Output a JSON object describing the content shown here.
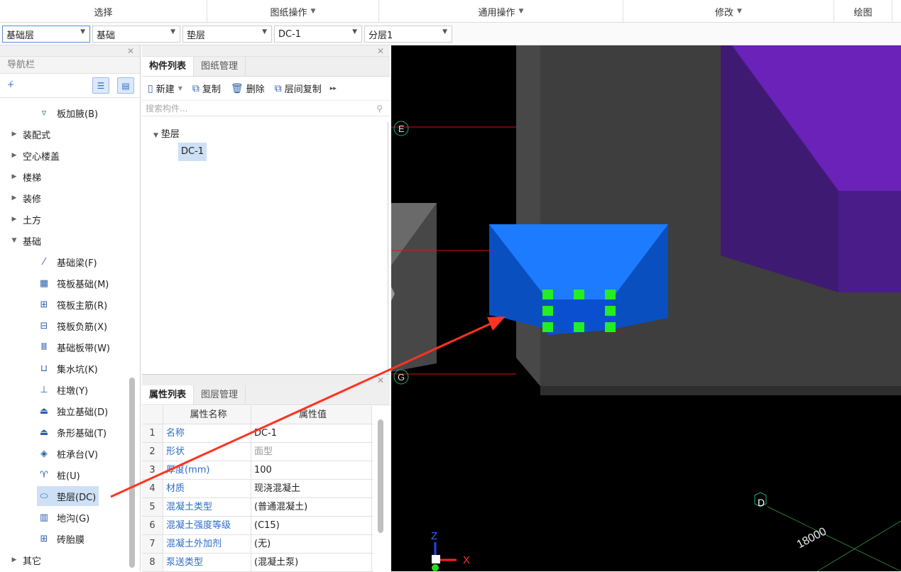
{
  "ribbon": {
    "groups": [
      {
        "label": "选择"
      },
      {
        "label": "图纸操作"
      },
      {
        "label": "通用操作"
      },
      {
        "label": "修改"
      },
      {
        "label": "绘图"
      }
    ]
  },
  "selectors": [
    {
      "value": "基础层"
    },
    {
      "value": "基础"
    },
    {
      "value": "垫层"
    },
    {
      "value": "DC-1"
    },
    {
      "value": "分层1"
    }
  ],
  "nav": {
    "title": "导航栏",
    "items": [
      {
        "label": "板加腋(B)",
        "icon": "slab-haunch-icon"
      },
      {
        "label": "装配式",
        "icon": "expand-arrow-icon"
      },
      {
        "label": "空心楼盖",
        "icon": "expand-arrow-icon"
      },
      {
        "label": "楼梯",
        "icon": "expand-arrow-icon"
      },
      {
        "label": "装修",
        "icon": "expand-arrow-icon"
      },
      {
        "label": "土方",
        "icon": "expand-arrow-icon"
      },
      {
        "label": "基础",
        "icon": "collapse-arrow-icon"
      },
      {
        "label": "基础梁(F)",
        "icon": "foundation-beam-icon"
      },
      {
        "label": "筏板基础(M)",
        "icon": "raft-foundation-icon"
      },
      {
        "label": "筏板主筋(R)",
        "icon": "raft-main-rebar-icon"
      },
      {
        "label": "筏板负筋(X)",
        "icon": "raft-negative-rebar-icon"
      },
      {
        "label": "基础板带(W)",
        "icon": "foundation-strip-icon"
      },
      {
        "label": "集水坑(K)",
        "icon": "sump-pit-icon"
      },
      {
        "label": "柱墩(Y)",
        "icon": "column-pier-icon"
      },
      {
        "label": "独立基础(D)",
        "icon": "isolated-footing-icon"
      },
      {
        "label": "条形基础(T)",
        "icon": "strip-footing-icon"
      },
      {
        "label": "桩承台(V)",
        "icon": "pile-cap-icon"
      },
      {
        "label": "桩(U)",
        "icon": "pile-icon"
      },
      {
        "label": "垫层(DC)",
        "icon": "cushion-layer-icon"
      },
      {
        "label": "地沟(G)",
        "icon": "trench-icon"
      },
      {
        "label": "砖胎膜",
        "icon": "brick-formwork-icon"
      },
      {
        "label": "其它",
        "icon": "expand-arrow-icon"
      }
    ]
  },
  "component_list": {
    "tabs": [
      "构件列表",
      "图纸管理"
    ],
    "toolbar": {
      "new": "新建",
      "copy": "复制",
      "delete": "删除",
      "floor_copy": "层间复制"
    },
    "search_placeholder": "搜索构件...",
    "group": "垫层",
    "item": "DC-1"
  },
  "properties": {
    "tabs": [
      "属性列表",
      "图层管理"
    ],
    "header": {
      "name": "属性名称",
      "value": "属性值"
    },
    "rows": [
      {
        "n": "1",
        "name": "名称",
        "value": "DC-1",
        "greyed": false
      },
      {
        "n": "2",
        "name": "形状",
        "value": "面型",
        "greyed": true
      },
      {
        "n": "3",
        "name": "厚度(mm)",
        "value": "100",
        "greyed": false
      },
      {
        "n": "4",
        "name": "材质",
        "value": "现浇混凝土",
        "greyed": false
      },
      {
        "n": "5",
        "name": "混凝土类型",
        "value": "(普通混凝土)",
        "greyed": false
      },
      {
        "n": "6",
        "name": "混凝土强度等级",
        "value": "(C15)",
        "greyed": false
      },
      {
        "n": "7",
        "name": "混凝土外加剂",
        "value": "(无)",
        "greyed": false
      },
      {
        "n": "8",
        "name": "泵送类型",
        "value": "(混凝土泵)",
        "greyed": false
      }
    ]
  },
  "viewport": {
    "axis_labels": [
      "E",
      "G",
      "D"
    ],
    "dimension": "18000",
    "coord_axes": {
      "x": "X",
      "z": "Z"
    },
    "colors": {
      "cushion": "#0a5fe0",
      "cushion_top": "#1d7bff",
      "purple": "#5a1fa0",
      "grip": "#22ee22",
      "annotation_arrow": "#ff3322"
    }
  }
}
